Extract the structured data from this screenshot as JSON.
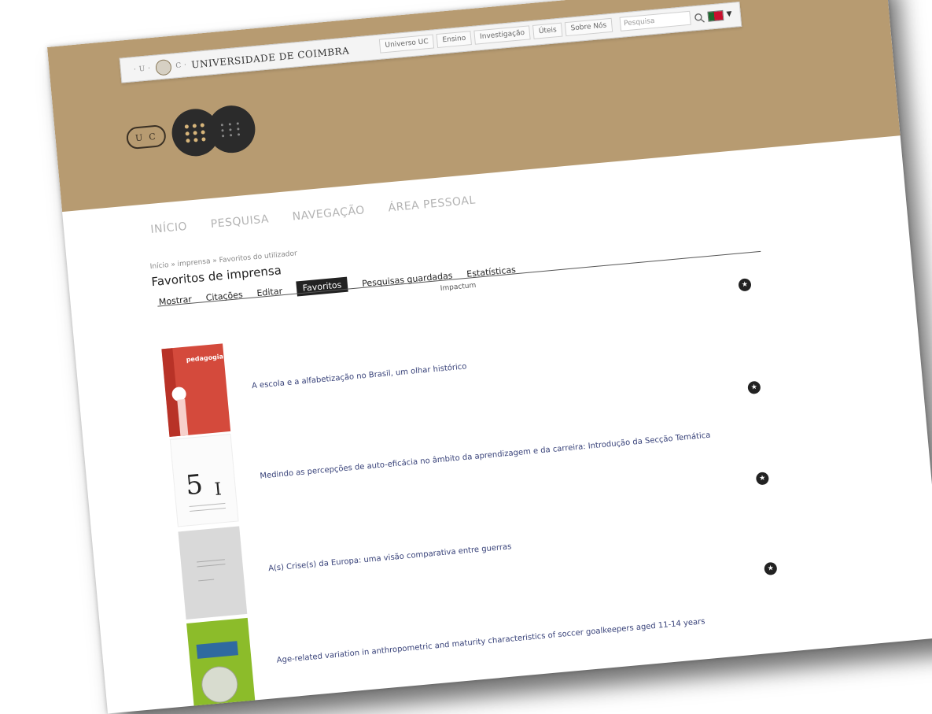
{
  "header": {
    "brand": "UNIVERSIDADE DE COIMBRA",
    "brand_prefix": "· U ·",
    "brand_sep": "C ·",
    "nav": [
      "Universo UC",
      "Ensino",
      "Investigação",
      "Úteis",
      "Sobre Nós"
    ],
    "search_placeholder": "Pesquisa"
  },
  "banner": {
    "uc_mark": "UC"
  },
  "main_nav": [
    "INÍCIO",
    "PESQUISA",
    "NAVEGAÇÃO",
    "ÁREA PESSOAL"
  ],
  "breadcrumb": "Início » imprensa » Favoritos do utilizador",
  "page_title": "Favoritos de imprensa",
  "tabs": [
    {
      "label": "Mostrar",
      "active": false
    },
    {
      "label": "Citações",
      "active": false
    },
    {
      "label": "Editar",
      "active": false
    },
    {
      "label": "Favoritos",
      "active": true
    },
    {
      "label": "Pesquisas guardadas",
      "active": false
    },
    {
      "label": "Estatísticas",
      "active": false
    }
  ],
  "section_label": "Impactum",
  "items": [
    {
      "title": "A escola e a alfabetização no Brasil, um olhar histórico",
      "cover_label": "pedagogia"
    },
    {
      "title": "Medindo as percepções de auto-eficácia no âmbito da aprendizagem e da carreira: Introdução da Secção Temática",
      "cover_label": "5"
    },
    {
      "title": "A(s) Crise(s) da Europa: uma visão comparativa entre guerras",
      "cover_label": ""
    },
    {
      "title": "Age-related variation in anthropometric and maturity characteristics of soccer goalkeepers aged 11-14 years",
      "cover_label": ""
    }
  ],
  "colors": {
    "banner": "#b79b71",
    "link": "#39437a",
    "active_tab": "#222222"
  },
  "icons": {
    "favorite": "star-icon",
    "search": "search-icon",
    "language": "flag-pt-icon"
  }
}
